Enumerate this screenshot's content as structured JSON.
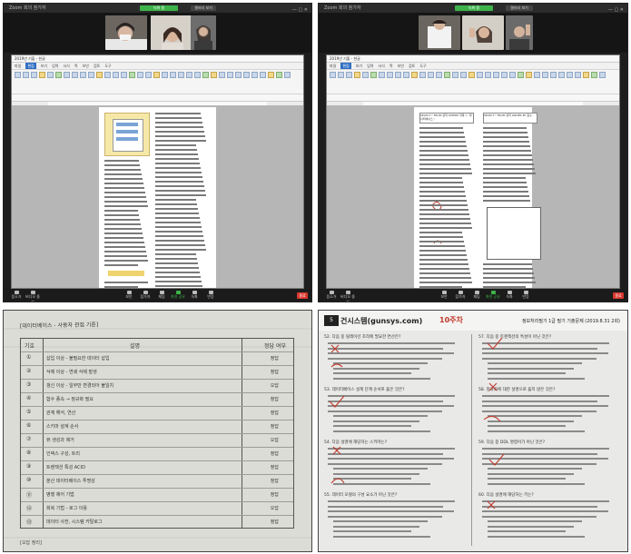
{
  "zoom_left": {
    "window_title": "Zoom 회의 참가자",
    "recording_label": "녹화 중",
    "view_label": "갤러리 보기",
    "hwp_title": "2019년 기출 - 한글",
    "hwp_tabs": [
      "파일",
      "편집",
      "보기",
      "입력",
      "서식",
      "쪽",
      "보안",
      "검토",
      "도구"
    ],
    "toolbar": [
      "음소거",
      "비디오 중지",
      "보안",
      "참가자",
      "채팅",
      "화면 공유",
      "녹화",
      "반응"
    ],
    "end_label": "종료",
    "page_header": "1과목 : 데이터베이스 구축"
  },
  "zoom_right": {
    "window_title": "Zoom 회의 참가자",
    "recording_label": "녹화 중",
    "view_label": "갤러리 보기",
    "hwp_title": "2019년 기출 - 한글",
    "hwp_tabs": [
      "파일",
      "편집",
      "보기",
      "입력",
      "서식",
      "쪽",
      "보안",
      "검토",
      "도구"
    ],
    "toolbar": [
      "음소거",
      "비디오 중지",
      "보안",
      "참가자",
      "채팅",
      "화면 공유",
      "녹화",
      "반응"
    ],
    "end_label": "종료",
    "sql_box_1": "SELECT * FROM 성적 WHERE 과목 = '데이터베이스';",
    "sql_box_2": "SELECT * FROM 성적 ORDER BY 점수;"
  },
  "notebook": {
    "title": "[데이터베이스 - 사용자 관점 기준]",
    "col_key": "기호",
    "col_content": "설명",
    "col_result": "정답 여부",
    "rows": [
      {
        "key": "①",
        "text": "삽입 이상 - 불필요한 데이터 삽입",
        "result": "정답"
      },
      {
        "key": "②",
        "text": "삭제 이상 - 연쇄 삭제 발생",
        "result": "정답"
      },
      {
        "key": "③",
        "text": "갱신 이상 - 일부만 변경되어 불일치",
        "result": "오답"
      },
      {
        "key": "④",
        "text": "함수 종속 → 정규화 필요",
        "result": "정답"
      },
      {
        "key": "⑤",
        "text": "관계 해석, 연산",
        "result": "정답"
      },
      {
        "key": "⑥",
        "text": "스키마 설계 순서",
        "result": "정답"
      },
      {
        "key": "⑦",
        "text": "뷰 생성과 제거",
        "result": "오답"
      },
      {
        "key": "⑧",
        "text": "인덱스 구성, 트리",
        "result": "정답"
      },
      {
        "key": "⑨",
        "text": "트랜잭션 특성 ACID",
        "result": "정답"
      },
      {
        "key": "⑩",
        "text": "분산 데이터베이스 투명성",
        "result": "정답"
      },
      {
        "key": "⑪",
        "text": "병행 제어 기법",
        "result": "정답"
      },
      {
        "key": "⑫",
        "text": "회복 기법 - 로그 이용",
        "result": "오답"
      },
      {
        "key": "⑬",
        "text": "데이터 사전, 시스템 카탈로그",
        "result": "정답"
      }
    ],
    "footer": "[오답 정리]"
  },
  "exam": {
    "badge": "5",
    "publisher": "건시스템(gunsys.com)",
    "week": "10주차",
    "info": "정보처리필기 1급 필기 기출문제 (2019.8.31 2회)",
    "q_left": [
      "52. 다음 중 릴레이션 조작에 필요한 연산은?",
      "53. 데이터베이스 설계 단계 순서로 옳은 것은?",
      "54. 다음 설명에 해당하는 스키마는?",
      "55. 데이터 모델의 구성 요소가 아닌 것은?"
    ],
    "q_right": [
      "57. 다음 중 트랜잭션의 특성이 아닌 것은?",
      "58. 정규화에 대한 설명으로 옳지 않은 것은?",
      "59. 다음 중 DDL 명령어가 아닌 것은?",
      "60. 다음 설명에 해당하는 키는?"
    ]
  },
  "colors": {
    "zoom_bg": "#1e1e1e",
    "zoom_green": "#3db34a",
    "end_red": "#d8372e",
    "hwp_ribbon_blue": "#2f6fc4",
    "red_pen": "#c0392b"
  }
}
